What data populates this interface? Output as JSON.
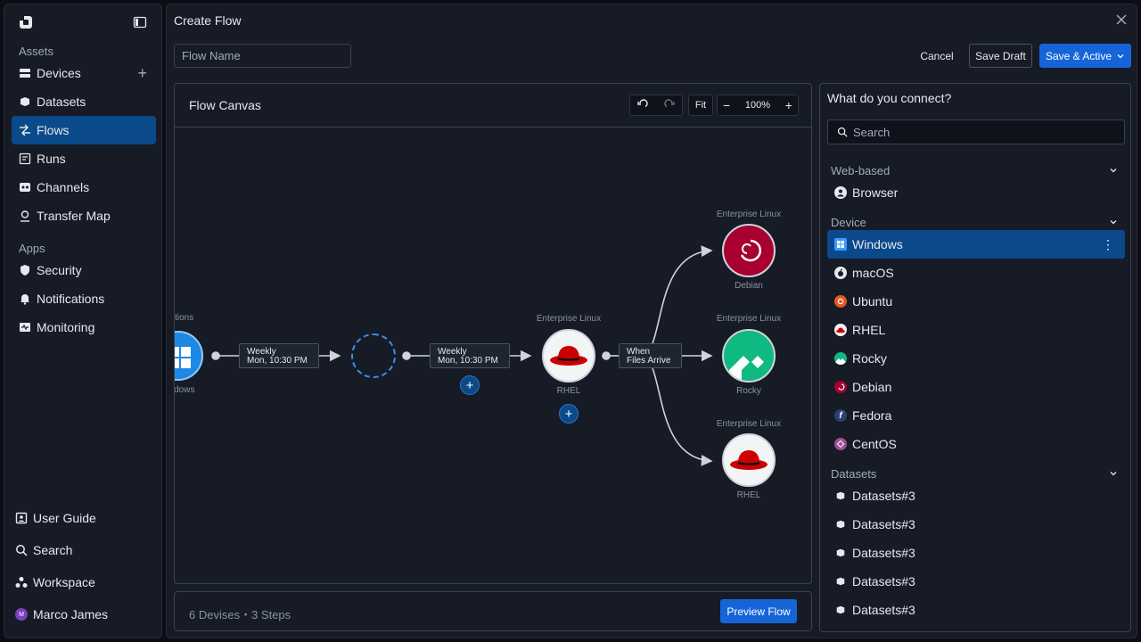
{
  "sidebar": {
    "sections": {
      "assets": "Assets",
      "apps": "Apps"
    },
    "items": [
      {
        "label": "Devices"
      },
      {
        "label": "Datasets"
      },
      {
        "label": "Flows"
      },
      {
        "label": "Runs"
      },
      {
        "label": "Channels"
      },
      {
        "label": "Transfer Map"
      }
    ],
    "apps": [
      {
        "label": "Security"
      },
      {
        "label": "Notifications"
      },
      {
        "label": "Monitoring"
      }
    ],
    "bottom": [
      {
        "label": "User Guide"
      },
      {
        "label": "Search"
      },
      {
        "label": "Workspace"
      },
      {
        "label": "Marco James"
      }
    ],
    "avatar_initial": "M"
  },
  "header": {
    "title": "Create Flow",
    "flow_name_placeholder": "Flow Name",
    "cancel": "Cancel",
    "save_draft": "Save Draft",
    "save_active": "Save & Active"
  },
  "canvas": {
    "title": "Flow Canvas",
    "fit": "Fit",
    "zoom": "100%",
    "nodes": {
      "windows_top": "stations",
      "windows_bottom": "ndows",
      "rhel_top": "Enterprise Linux",
      "rhel_bottom": "RHEL",
      "debian_top": "Enterprise Linux",
      "debian_bottom": "Debian",
      "rocky_top": "Enterprise Linux",
      "rocky_bottom": "Rocky",
      "rhel2_top": "Enterprise Linux",
      "rhel2_bottom": "RHEL"
    },
    "schedules": {
      "s1_line1": "Weekly",
      "s1_line2": "Mon, 10:30 PM",
      "s2_line1": "Weekly",
      "s2_line2": "Mon, 10:30 PM",
      "s3_line1": "When",
      "s3_line2": "Files Arrive"
    },
    "add": "+"
  },
  "footer": {
    "stats": "6 Devises・3 Steps",
    "preview": "Preview Flow"
  },
  "panel": {
    "title": "What do you connect?",
    "search_placeholder": "Search",
    "groups": {
      "web": "Web-based",
      "device": "Device",
      "datasets": "Datasets"
    },
    "web_items": [
      "Browser"
    ],
    "device_items": [
      "Windows",
      "macOS",
      "Ubuntu",
      "RHEL",
      "Rocky",
      "Debian",
      "Fedora",
      "CentOS"
    ],
    "dataset_items": [
      "Datasets#3",
      "Datasets#3",
      "Datasets#3",
      "Datasets#3",
      "Datasets#3"
    ]
  },
  "colors": {
    "accent": "#0b4a8a",
    "primary_button": "#1565d8",
    "rhel_red": "#cc0000",
    "debian_red": "#a80030",
    "rocky_green": "#10b981",
    "selection_ring": "#3b8eea"
  }
}
